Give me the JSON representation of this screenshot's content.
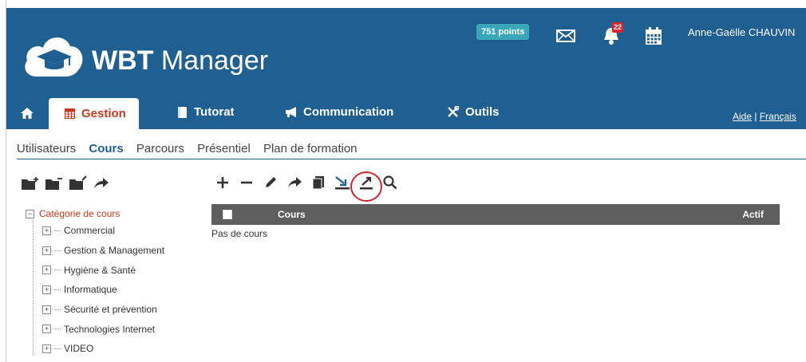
{
  "header": {
    "app_name_bold": "WBT",
    "app_name_rest": " Manager",
    "points": "751 points",
    "notifications_count": "22",
    "user_name": "Anne-Gaëlle CHAUVIN",
    "links": {
      "help": "Aide",
      "separator": " | ",
      "language": "Français"
    },
    "colors": {
      "header_bg": "#1f5f91",
      "accent": "#c23b22",
      "points_bg": "#3aa6b9"
    }
  },
  "tabs": [
    {
      "label": "Gestion",
      "icon": "table-icon",
      "active": true
    },
    {
      "label": "Tutorat",
      "icon": "book-icon"
    },
    {
      "label": "Communication",
      "icon": "megaphone-icon"
    },
    {
      "label": "Outils",
      "icon": "tools-icon"
    }
  ],
  "subnav": [
    "Utilisateurs",
    "Cours",
    "Parcours",
    "Présentiel",
    "Plan de formation"
  ],
  "toolbar_left": [
    "folder-add-icon",
    "folder-remove-icon",
    "folder-edit-icon",
    "move-arrow-icon"
  ],
  "toolbar_main": [
    "plus-icon",
    "minus-icon",
    "pencil-icon",
    "move-arrow-icon",
    "copy-icon",
    "import-icon",
    "export-icon",
    "search-icon"
  ],
  "tree": {
    "root": "Catégorie de cours",
    "items": [
      "Commercial",
      "Gestion & Management",
      "Hygiène & Santé",
      "Informatique",
      "Sécurité et prévention",
      "Technologies Internet",
      "VIDEO"
    ]
  },
  "grid": {
    "col_cours": "Cours",
    "col_actif": "Actif",
    "empty_text": "Pas de cours"
  }
}
